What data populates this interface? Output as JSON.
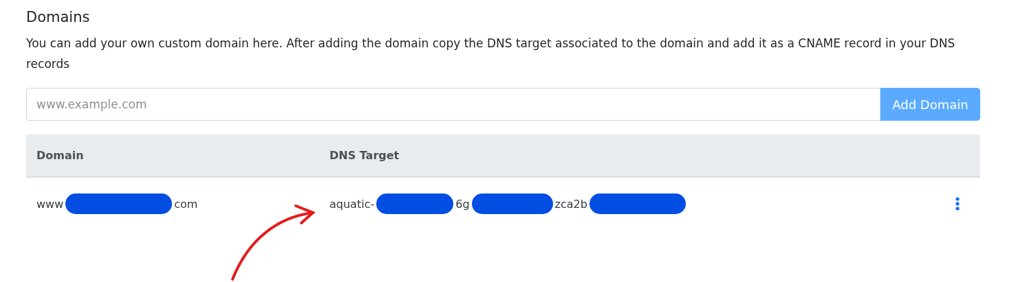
{
  "heading": "Domains",
  "description": "You can add your own custom domain here. After adding the domain copy the DNS target associated to the domain and add it as a CNAME record in your DNS records",
  "domain_input": {
    "placeholder": "www.example.com"
  },
  "add_button": "Add Domain",
  "table": {
    "columns": [
      "Domain",
      "DNS Target"
    ],
    "rows": [
      {
        "cells": [
          [
            {
              "kind": "text",
              "text": "www"
            },
            {
              "kind": "redacted"
            },
            {
              "kind": "text",
              "text": "com"
            }
          ],
          [
            {
              "kind": "text",
              "text": "aquatic-"
            },
            {
              "kind": "redacted"
            },
            {
              "kind": "text",
              "text": "6g"
            },
            {
              "kind": "redacted"
            },
            {
              "kind": "text",
              "text": "zca2b"
            },
            {
              "kind": "redacted"
            }
          ]
        ]
      }
    ]
  }
}
